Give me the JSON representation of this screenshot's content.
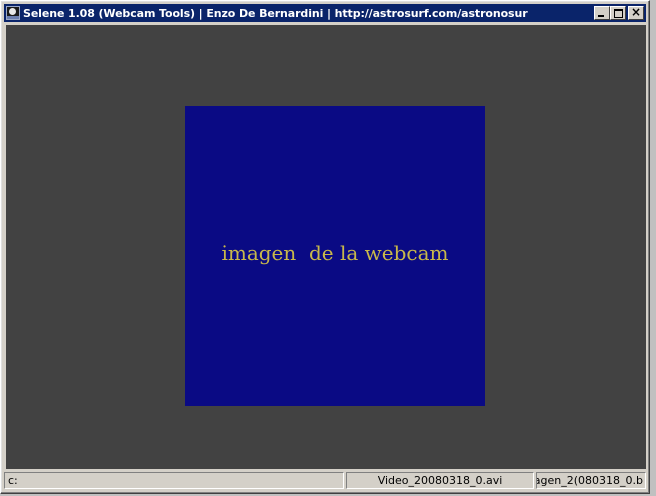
{
  "window": {
    "title": "Selene 1.08 (Webcam Tools) | Enzo De Bernardini | http://astrosurf.com/astronosur"
  },
  "viewer": {
    "placeholder_text": "imagen  de la webcam"
  },
  "statusbar": {
    "drive": "c:",
    "video_file": "Video_20080318_0.avi",
    "image_file": "agen_2(080318_0.b"
  },
  "colors": {
    "titlebar": "#0a246a",
    "client_bg": "#424242",
    "webcam_bg": "#0a0a84",
    "webcam_text": "#c8b84a"
  },
  "icons": [
    "selene-app-icon",
    "minimize-icon",
    "maximize-icon",
    "close-icon"
  ]
}
